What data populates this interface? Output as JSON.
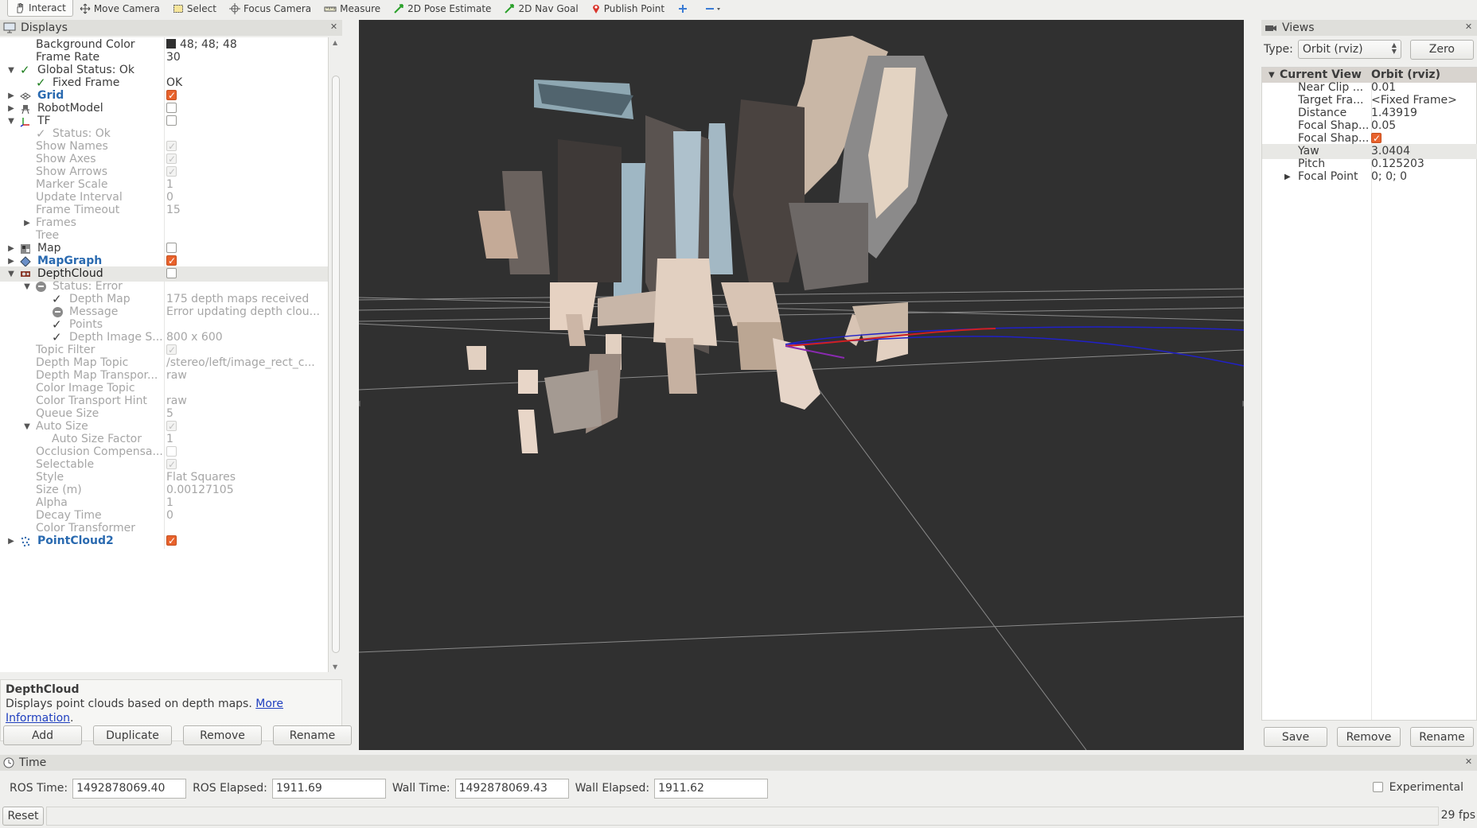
{
  "toolbar": {
    "tools": [
      {
        "label": "Interact",
        "icon": "hand-icon"
      },
      {
        "label": "Move Camera",
        "icon": "move-camera-icon"
      },
      {
        "label": "Select",
        "icon": "select-icon"
      },
      {
        "label": "Focus Camera",
        "icon": "focus-camera-icon"
      },
      {
        "label": "Measure",
        "icon": "ruler-icon"
      },
      {
        "label": "2D Pose Estimate",
        "icon": "green-arrow-icon"
      },
      {
        "label": "2D Nav Goal",
        "icon": "green-arrow-icon"
      },
      {
        "label": "Publish Point",
        "icon": "pin-icon"
      }
    ],
    "active": "Interact"
  },
  "displays": {
    "title": "Displays",
    "rows": [
      {
        "label": "Background Color",
        "value": "48; 48; 48"
      },
      {
        "label": "Frame Rate",
        "value": "30"
      },
      {
        "label": "Global Status: Ok"
      },
      {
        "label": "Fixed Frame",
        "value": "OK"
      },
      {
        "label": "Grid"
      },
      {
        "label": "RobotModel"
      },
      {
        "label": "TF"
      },
      {
        "label": "Status: Ok"
      },
      {
        "label": "Show Names"
      },
      {
        "label": "Show Axes"
      },
      {
        "label": "Show Arrows"
      },
      {
        "label": "Marker Scale",
        "value": "1"
      },
      {
        "label": "Update Interval",
        "value": "0"
      },
      {
        "label": "Frame Timeout",
        "value": "15"
      },
      {
        "label": "Frames"
      },
      {
        "label": "Tree"
      },
      {
        "label": "Map"
      },
      {
        "label": "MapGraph"
      },
      {
        "label": "DepthCloud"
      },
      {
        "label": "Status: Error"
      },
      {
        "label": "Depth Map",
        "value": "175 depth maps received"
      },
      {
        "label": "Message",
        "value": "Error updating depth clou..."
      },
      {
        "label": "Points"
      },
      {
        "label": "Depth Image S...",
        "value": "800 x 600"
      },
      {
        "label": "Topic Filter"
      },
      {
        "label": "Depth Map Topic",
        "value": "/stereo/left/image_rect_c..."
      },
      {
        "label": "Depth Map Transpor...",
        "value": "raw"
      },
      {
        "label": "Color Image Topic",
        "value": ""
      },
      {
        "label": "Color Transport Hint",
        "value": "raw"
      },
      {
        "label": "Queue Size",
        "value": "5"
      },
      {
        "label": "Auto Size"
      },
      {
        "label": "Auto Size Factor",
        "value": "1"
      },
      {
        "label": "Occlusion Compensa..."
      },
      {
        "label": "Selectable"
      },
      {
        "label": "Style",
        "value": "Flat Squares"
      },
      {
        "label": "Size (m)",
        "value": "0.00127105"
      },
      {
        "label": "Alpha",
        "value": "1"
      },
      {
        "label": "Decay Time",
        "value": "0"
      },
      {
        "label": "Color Transformer",
        "value": ""
      },
      {
        "label": "PointCloud2"
      }
    ],
    "description": {
      "title": "DepthCloud",
      "text": "Displays point clouds based on depth maps.",
      "link_1": "More",
      "link_2": "Information",
      "period": "."
    },
    "buttons": [
      "Add",
      "Duplicate",
      "Remove",
      "Rename"
    ]
  },
  "views": {
    "title": "Views",
    "type_label": "Type:",
    "type_value": "Orbit (rviz)",
    "zero_label": "Zero",
    "header_key": "Current View",
    "header_value": "Orbit (rviz)",
    "props": [
      {
        "key": "Near Clip ...",
        "value": "0.01"
      },
      {
        "key": "Target Fra...",
        "value": "<Fixed Frame>"
      },
      {
        "key": "Distance",
        "value": "1.43919"
      },
      {
        "key": "Focal Shap...",
        "value": "0.05"
      },
      {
        "key": "Focal Shap...",
        "value": ""
      },
      {
        "key": "Yaw",
        "value": "3.0404"
      },
      {
        "key": "Pitch",
        "value": "0.125203"
      },
      {
        "key": "Focal Point",
        "value": "0; 0; 0"
      }
    ],
    "buttons": [
      "Save",
      "Remove",
      "Rename"
    ]
  },
  "time": {
    "title": "Time",
    "ros_time_label": "ROS Time:",
    "ros_time": "1492878069.40",
    "ros_elapsed_label": "ROS Elapsed:",
    "ros_elapsed": "1911.69",
    "wall_time_label": "Wall Time:",
    "wall_time": "1492878069.43",
    "wall_elapsed_label": "Wall Elapsed:",
    "wall_elapsed": "1911.62",
    "experimental_label": "Experimental"
  },
  "status": {
    "reset_label": "Reset",
    "fps": "29 fps"
  },
  "colors": {
    "background": "#303030",
    "accent": "#e8622c",
    "link": "#2a6ab0"
  }
}
